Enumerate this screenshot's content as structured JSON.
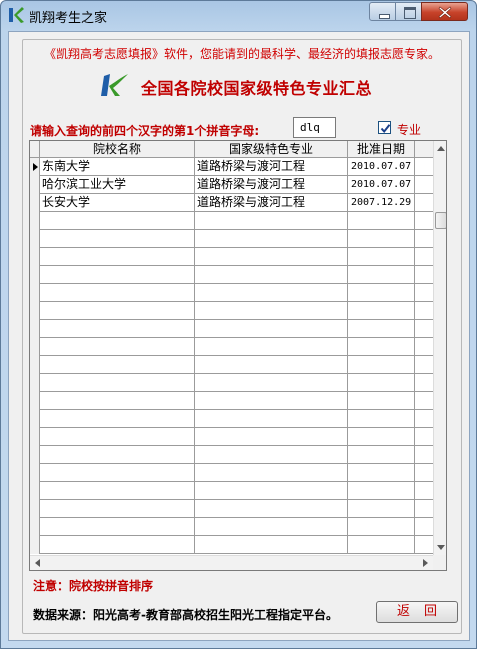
{
  "window": {
    "title": "凯翔考生之家"
  },
  "header": {
    "slogan": "《凯翔高考志愿填报》软件，您能请到的最科学、最经济的填报志愿专家。",
    "title": "全国各院校国家级特色专业汇总"
  },
  "search": {
    "label": "请输入查询的前四个汉字的第1个拼音字母:",
    "value": "dlq",
    "checkbox_label": "专业",
    "checkbox_checked": true
  },
  "table": {
    "columns": [
      "院校名称",
      "国家级特色专业",
      "批准日期"
    ],
    "rows": [
      [
        "东南大学",
        "道路桥梁与渡河工程",
        "2010.07.07"
      ],
      [
        "哈尔滨工业大学",
        "道路桥梁与渡河工程",
        "2010.07.07"
      ],
      [
        "长安大学",
        "道路桥梁与渡河工程",
        "2007.12.29"
      ]
    ]
  },
  "footer": {
    "note": "注意：院校按拼音排序",
    "source": "数据来源：阳光高考-教育部高校招生阳光工程指定平台。",
    "back_label": "返回"
  },
  "colors": {
    "accent_red": "#c00000",
    "title_bar": "#bcd4ec",
    "logo_green": "#3a9a2a",
    "logo_blue": "#1f5ea8"
  }
}
